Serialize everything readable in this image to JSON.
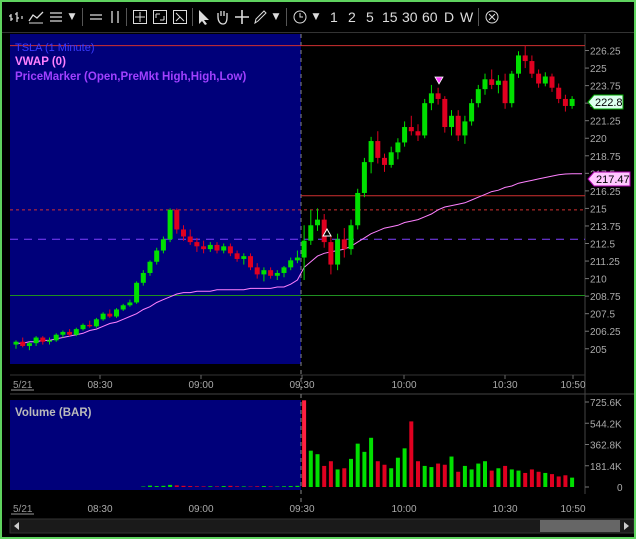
{
  "toolbar": {
    "icons": [
      "bar-chart-icon",
      "chart-style-icon",
      "list-icon",
      "dropdown-icon",
      "lines-icon",
      "pause-icon",
      "crosshair-box-icon",
      "zoom-box-icon",
      "zoom-out-box-icon",
      "pointer-icon",
      "hand-icon",
      "crosshair-icon",
      "pencil-icon",
      "dropdown-icon",
      "clock-icon",
      "dropdown-icon",
      "close-circle-icon"
    ],
    "timeframes": [
      "1",
      "2",
      "5",
      "15",
      "30",
      "60",
      "D",
      "W"
    ]
  },
  "price_panel": {
    "instrument_label": "TSLA (1 Minute)",
    "indicator_vwap": "VWAP (0)",
    "indicator_pricemarker": "PriceMarker (Open,PreMkt High,High,Low)",
    "y_ticks": [
      "226.25",
      "225",
      "223.75",
      "222.5",
      "221.25",
      "220",
      "218.75",
      "217.5",
      "216.25",
      "215",
      "213.75",
      "212.5",
      "211.25",
      "210",
      "208.75",
      "207.5",
      "206.25",
      "205"
    ],
    "last_price_label": "222.8",
    "vwap_label": "217.47",
    "colors": {
      "up": "#00e000",
      "down": "#e00020",
      "vwap": "#ff80ff",
      "premarket_bg": "#00007a",
      "hline_red": "#d03030",
      "hline_green": "#209020",
      "hline_violet": "#8040ff"
    }
  },
  "volume_panel": {
    "label": "Volume (BAR)",
    "y_ticks": [
      "725.6K",
      "544.2K",
      "362.8K",
      "181.4K",
      "0"
    ]
  },
  "x_axis": {
    "date_label": "5/21",
    "time_labels": [
      "08:30",
      "09:00",
      "09:30",
      "10:00",
      "10:30",
      "10:50"
    ]
  },
  "chart_data": {
    "type": "candlestick",
    "title": "TSLA (1 Minute)",
    "ylim": [
      204.2,
      227
    ],
    "session_open": "09:30",
    "reference_lines": {
      "high": 226.6,
      "premarket_high": 215.9,
      "premarket_mid_dashed": 214.9,
      "open": 212.8,
      "low": 208.8
    },
    "candles": [
      [
        205.3,
        205.6,
        205.0,
        205.5
      ],
      [
        205.5,
        205.8,
        205.1,
        205.2
      ],
      [
        205.2,
        205.5,
        204.9,
        205.4
      ],
      [
        205.4,
        205.9,
        205.2,
        205.8
      ],
      [
        205.8,
        205.9,
        205.3,
        205.5
      ],
      [
        205.5,
        205.8,
        205.3,
        205.6
      ],
      [
        205.6,
        206.1,
        205.5,
        206.0
      ],
      [
        206.0,
        206.3,
        205.8,
        206.2
      ],
      [
        206.2,
        206.4,
        205.9,
        206.0
      ],
      [
        206.0,
        206.5,
        205.9,
        206.4
      ],
      [
        206.4,
        206.8,
        206.3,
        206.7
      ],
      [
        206.7,
        207.0,
        206.5,
        206.6
      ],
      [
        206.6,
        207.2,
        206.5,
        207.1
      ],
      [
        207.1,
        207.6,
        207.0,
        207.5
      ],
      [
        207.5,
        207.8,
        207.2,
        207.3
      ],
      [
        207.3,
        207.9,
        207.2,
        207.8
      ],
      [
        207.8,
        208.2,
        207.7,
        208.1
      ],
      [
        208.1,
        208.5,
        208.0,
        208.3
      ],
      [
        208.3,
        209.8,
        208.2,
        209.7
      ],
      [
        209.7,
        210.6,
        209.5,
        210.4
      ],
      [
        210.4,
        211.3,
        210.2,
        211.2
      ],
      [
        211.2,
        212.2,
        211.0,
        212.0
      ],
      [
        212.0,
        213.0,
        211.8,
        212.8
      ],
      [
        212.8,
        215.0,
        212.6,
        214.9
      ],
      [
        214.9,
        215.0,
        213.2,
        213.5
      ],
      [
        213.5,
        213.8,
        212.7,
        213.0
      ],
      [
        213.0,
        213.5,
        212.4,
        212.6
      ],
      [
        212.6,
        212.9,
        211.9,
        212.3
      ],
      [
        212.3,
        212.7,
        211.8,
        212.1
      ],
      [
        212.1,
        212.6,
        211.9,
        212.4
      ],
      [
        212.4,
        212.6,
        211.8,
        212.0
      ],
      [
        212.0,
        212.5,
        211.8,
        212.3
      ],
      [
        212.3,
        212.5,
        211.6,
        211.8
      ],
      [
        211.8,
        212.0,
        211.2,
        211.4
      ],
      [
        211.4,
        211.8,
        211.0,
        211.6
      ],
      [
        211.6,
        211.8,
        210.6,
        210.8
      ],
      [
        210.8,
        211.1,
        210.0,
        210.3
      ],
      [
        210.3,
        210.8,
        209.8,
        210.6
      ],
      [
        210.6,
        210.8,
        210.0,
        210.2
      ],
      [
        210.2,
        210.6,
        209.9,
        210.4
      ],
      [
        210.4,
        210.9,
        210.1,
        210.8
      ],
      [
        210.8,
        211.5,
        210.6,
        211.3
      ],
      [
        211.3,
        212.0,
        211.1,
        211.5
      ],
      [
        211.5,
        213.8,
        209.9,
        212.7
      ],
      [
        212.7,
        214.9,
        212.4,
        213.8
      ],
      [
        213.8,
        215.0,
        213.4,
        214.2
      ],
      [
        214.2,
        214.6,
        212.2,
        212.6
      ],
      [
        212.6,
        213.0,
        210.3,
        211.0
      ],
      [
        211.0,
        213.2,
        210.6,
        212.8
      ],
      [
        212.8,
        213.6,
        211.5,
        212.1
      ],
      [
        212.1,
        214.2,
        211.7,
        213.8
      ],
      [
        213.8,
        216.4,
        213.5,
        216.1
      ],
      [
        216.1,
        218.6,
        215.8,
        218.3
      ],
      [
        218.3,
        220.1,
        217.5,
        219.8
      ],
      [
        219.8,
        220.5,
        218.2,
        218.6
      ],
      [
        218.6,
        218.9,
        217.6,
        218.1
      ],
      [
        218.1,
        219.4,
        217.9,
        219.0
      ],
      [
        219.0,
        220.0,
        218.5,
        219.7
      ],
      [
        219.7,
        221.2,
        219.4,
        220.8
      ],
      [
        220.8,
        221.6,
        220.2,
        220.5
      ],
      [
        220.5,
        221.0,
        219.8,
        220.2
      ],
      [
        220.2,
        222.8,
        220.0,
        222.5
      ],
      [
        222.5,
        223.8,
        222.0,
        223.2
      ],
      [
        223.2,
        223.6,
        222.4,
        222.8
      ],
      [
        222.8,
        223.0,
        220.4,
        220.8
      ],
      [
        220.8,
        222.0,
        220.2,
        221.6
      ],
      [
        221.6,
        222.0,
        219.8,
        220.2
      ],
      [
        220.2,
        221.6,
        219.6,
        221.2
      ],
      [
        221.2,
        222.8,
        220.9,
        222.5
      ],
      [
        222.5,
        223.8,
        222.2,
        223.5
      ],
      [
        223.5,
        224.6,
        223.1,
        224.2
      ],
      [
        224.2,
        224.9,
        223.5,
        223.8
      ],
      [
        223.8,
        224.5,
        223.2,
        224.1
      ],
      [
        224.1,
        224.6,
        222.1,
        222.5
      ],
      [
        222.5,
        224.8,
        222.2,
        224.6
      ],
      [
        224.6,
        226.2,
        224.3,
        225.9
      ],
      [
        225.9,
        226.6,
        225.0,
        225.5
      ],
      [
        225.5,
        225.9,
        224.3,
        224.6
      ],
      [
        224.6,
        224.9,
        223.6,
        223.9
      ],
      [
        223.9,
        224.7,
        223.7,
        224.4
      ],
      [
        224.4,
        224.6,
        223.3,
        223.6
      ],
      [
        223.6,
        223.9,
        222.5,
        222.8
      ],
      [
        222.8,
        223.1,
        221.9,
        222.3
      ],
      [
        222.3,
        223.0,
        222.1,
        222.8
      ]
    ],
    "vwap": [
      205.4,
      205.4,
      205.5,
      205.5,
      205.6,
      205.6,
      205.7,
      205.8,
      205.9,
      206.0,
      206.1,
      206.3,
      206.4,
      206.6,
      206.8,
      206.9,
      207.1,
      207.3,
      207.5,
      207.8,
      208.0,
      208.3,
      208.5,
      208.7,
      208.9,
      209.0,
      209.0,
      209.1,
      209.1,
      209.1,
      209.2,
      209.2,
      209.2,
      209.2,
      209.2,
      209.3,
      209.3,
      209.3,
      209.3,
      209.4,
      209.4,
      209.6,
      209.9,
      210.8,
      211.2,
      211.6,
      211.8,
      211.9,
      212.0,
      212.1,
      212.3,
      212.6,
      212.9,
      213.2,
      213.4,
      213.6,
      213.7,
      213.8,
      214.0,
      214.1,
      214.2,
      214.4,
      214.6,
      214.9,
      215.1,
      215.2,
      215.3,
      215.4,
      215.6,
      215.8,
      216.0,
      216.2,
      216.3,
      216.5,
      216.6,
      216.8,
      216.9,
      217.0,
      217.1,
      217.2,
      217.3,
      217.4,
      217.45,
      217.47
    ],
    "volume_k": [
      0,
      0,
      0,
      0,
      0,
      0,
      0,
      0,
      0,
      0,
      0,
      0,
      0,
      0,
      0,
      0,
      0,
      0,
      0,
      4,
      12,
      8,
      10,
      18,
      14,
      10,
      8,
      6,
      5,
      6,
      5,
      8,
      10,
      6,
      5,
      4,
      6,
      8,
      5,
      4,
      6,
      8,
      10,
      740,
      310,
      280,
      180,
      220,
      150,
      160,
      240,
      370,
      300,
      420,
      220,
      190,
      160,
      250,
      330,
      560,
      220,
      180,
      170,
      200,
      190,
      260,
      130,
      180,
      150,
      200,
      220,
      140,
      160,
      180,
      150,
      140,
      120,
      150,
      130,
      120,
      110,
      90,
      100,
      80
    ]
  }
}
